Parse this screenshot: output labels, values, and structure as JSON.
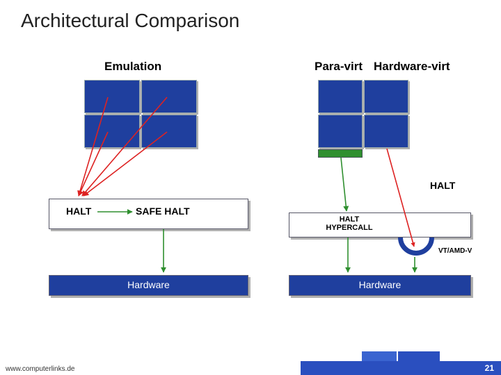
{
  "title": "Architectural Comparison",
  "columns": {
    "emulation": "Emulation",
    "para": "Para-virt",
    "hw": "Hardware-virt"
  },
  "labels": {
    "halt": "HALT",
    "safe_halt": "SAFE HALT",
    "halt_hypercall_l1": "HALT",
    "halt_hypercall_l2": "HYPERCALL",
    "hardware": "Hardware",
    "vt_amd": "VT/AMD-V"
  },
  "footer": {
    "url": "www.computerlinks.de",
    "page": "21"
  }
}
